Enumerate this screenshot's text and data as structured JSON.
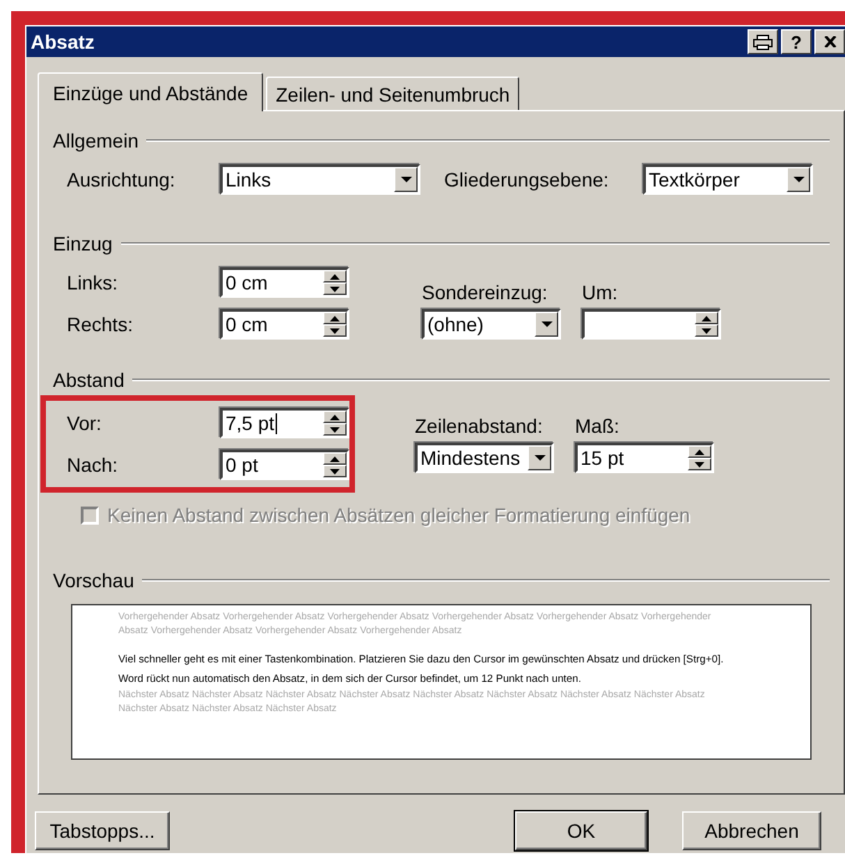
{
  "window": {
    "title": "Absatz",
    "title_buttons": [
      {
        "kind": "print"
      },
      {
        "kind": "help",
        "label": "?"
      },
      {
        "kind": "close"
      }
    ]
  },
  "tabs": [
    {
      "label": "Einzüge und Abstände",
      "selected": true
    },
    {
      "label": "Zeilen- und Seitenumbruch",
      "selected": false
    }
  ],
  "allgemein": {
    "title": "Allgemein",
    "ausrichtung": {
      "label": "Ausrichtung:",
      "value": "Links"
    },
    "gliederungsebene": {
      "label": "Gliederungsebene:",
      "value": "Textkörper"
    }
  },
  "einzug": {
    "title": "Einzug",
    "links": {
      "label": "Links:",
      "value": "0 cm"
    },
    "rechts": {
      "label": "Rechts:",
      "value": "0 cm"
    },
    "sondereinzug": {
      "label": "Sondereinzug:",
      "value": "(ohne)"
    },
    "um": {
      "label": "Um:"
    }
  },
  "abstand": {
    "title": "Abstand",
    "highlighted": true,
    "vor": {
      "label": "Vor:",
      "value": "7,5 pt",
      "focused": true
    },
    "nach": {
      "label": "Nach:",
      "value": "0 pt"
    },
    "zeilenabstand": {
      "label": "Zeilenabstand:",
      "value": "Mindestens"
    },
    "mass": {
      "label": "Maß:",
      "value": "15 pt"
    },
    "checkbox": {
      "label": "Keinen Abstand zwischen Absätzen gleicher Formatierung einfügen",
      "checked": false,
      "disabled": true
    }
  },
  "vorschau": {
    "title": "Vorschau",
    "previous": "Vorhergehender Absatz Vorhergehender Absatz Vorhergehender Absatz Vorhergehender Absatz Vorhergehender Absatz Vorhergehender Absatz Vorhergehender Absatz Vorhergehender Absatz Vorhergehender Absatz",
    "current": "Viel schneller geht es mit einer Tastenkombination. Platzieren Sie dazu den Cursor im gewünschten Absatz und drücken [Strg+0]. Word rückt nun automatisch den Absatz, in dem sich der Cursor befindet, um 12 Punkt nach unten.",
    "next": "Nächster Absatz Nächster Absatz Nächster Absatz Nächster Absatz Nächster Absatz Nächster Absatz Nächster Absatz Nächster Absatz Nächster Absatz Nächster Absatz Nächster Absatz"
  },
  "buttons": [
    {
      "label": "Tabstopps...",
      "default": false
    },
    {
      "label": "OK",
      "default": true
    },
    {
      "label": "Abbrechen",
      "default": false
    }
  ]
}
